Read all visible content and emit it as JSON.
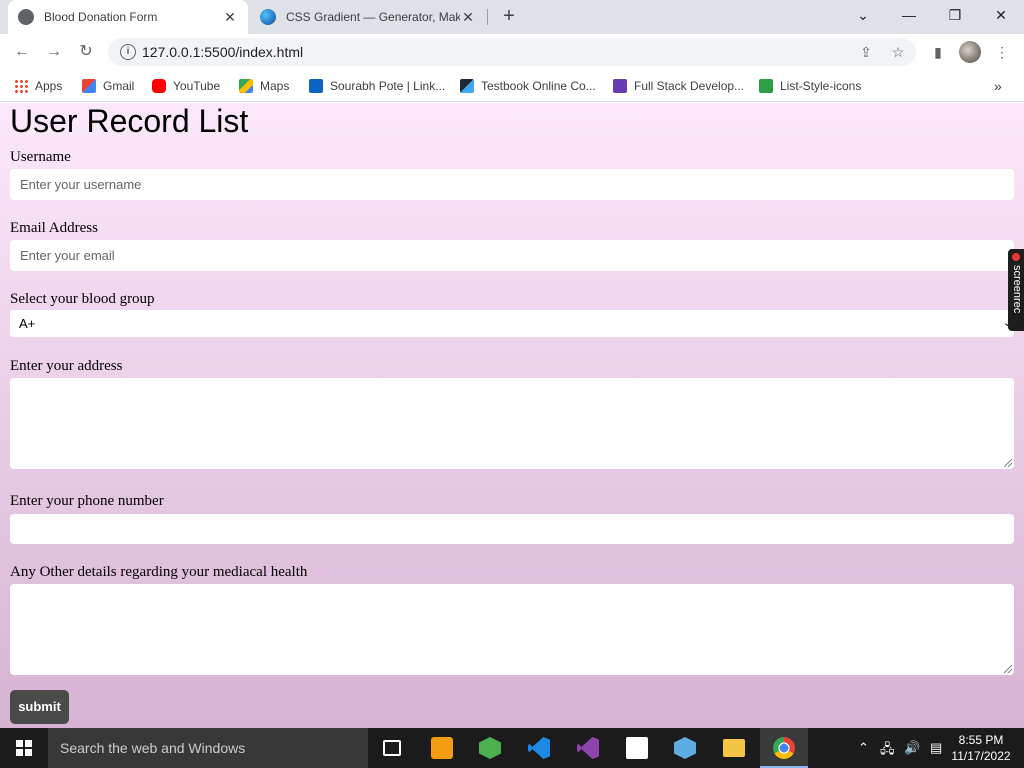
{
  "browser": {
    "tabs": [
      {
        "title": "Blood Donation Form",
        "active": true
      },
      {
        "title": "CSS Gradient — Generator, Maker",
        "active": false
      }
    ],
    "new_tab_icon": "plus-icon",
    "url": "127.0.0.1:5500/index.html",
    "bookmarks": [
      {
        "label": "Apps",
        "icon": "apps-grid-icon",
        "color": "#4285f4"
      },
      {
        "label": "Gmail",
        "icon": "gmail-icon",
        "color": "#ea4335"
      },
      {
        "label": "YouTube",
        "icon": "youtube-icon",
        "color": "#ff0000"
      },
      {
        "label": "Maps",
        "icon": "maps-icon",
        "color": "#34a853"
      },
      {
        "label": "Sourabh Pote | Link...",
        "icon": "linkedin-icon",
        "color": "#0a66c2"
      },
      {
        "label": "Testbook Online Co...",
        "icon": "testbook-icon",
        "color": "#1e2a38"
      },
      {
        "label": "Full Stack Develop...",
        "icon": "bookmark-page-icon",
        "color": "#673ab7"
      },
      {
        "label": "List-Style-icons",
        "icon": "list-icon",
        "color": "#2e9e48"
      }
    ]
  },
  "page": {
    "heading": "User Record List",
    "fields": {
      "username": {
        "label": "Username",
        "placeholder": "Enter your username"
      },
      "email": {
        "label": "Email Address",
        "placeholder": "Enter your email"
      },
      "blood_group": {
        "label": "Select your blood group",
        "value": "A+"
      },
      "address": {
        "label": "Enter your address"
      },
      "phone": {
        "label": "Enter your phone number"
      },
      "health": {
        "label": "Any Other details regarding your mediacal health"
      }
    },
    "submit_label": "submit",
    "screenrec_label": "screenrec"
  },
  "taskbar": {
    "search_placeholder": "Search the web and Windows",
    "time": "8:55 PM",
    "date": "11/17/2022"
  }
}
